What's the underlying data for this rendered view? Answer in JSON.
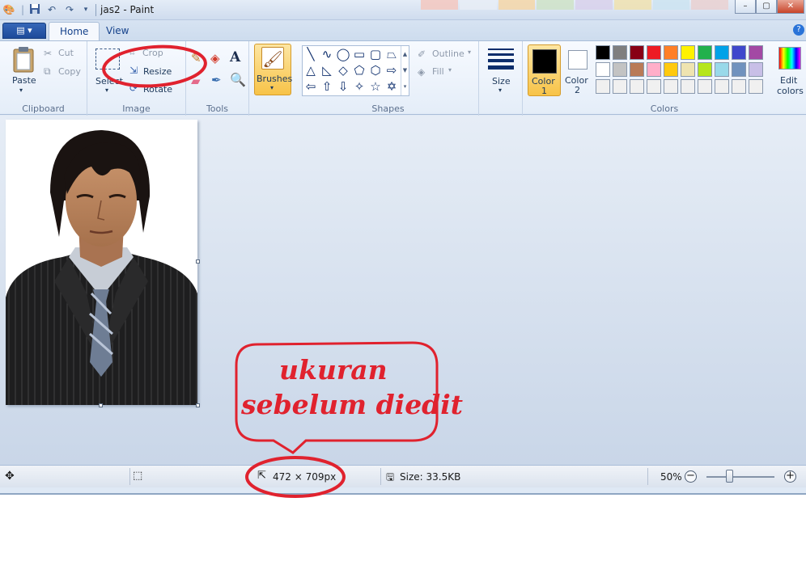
{
  "window": {
    "title": "jas2 - Paint",
    "system_buttons": {
      "minimize": "–",
      "maximize": "▢",
      "close": "✕"
    }
  },
  "quick_access": {
    "app_icon": "paint-palette-icon",
    "save_icon": "save-icon",
    "undo_icon": "undo-icon",
    "redo_icon": "redo-icon",
    "customize_icon": "dropdown-icon"
  },
  "tabs": {
    "app_menu": "▤ ▾",
    "home": "Home",
    "view": "View"
  },
  "ribbon": {
    "clipboard": {
      "label": "Clipboard",
      "paste": "Paste",
      "cut": "Cut",
      "copy": "Copy"
    },
    "image": {
      "label": "Image",
      "select": "Select",
      "crop": "Crop",
      "resize": "Resize",
      "rotate": "Rotate"
    },
    "tools": {
      "label": "Tools"
    },
    "brushes": {
      "label": "Brushes"
    },
    "shapes": {
      "label": "Shapes",
      "outline": "Outline",
      "fill": "Fill"
    },
    "size": {
      "label": "Size"
    },
    "colors": {
      "label": "Colors",
      "color1_label": "Color",
      "color1_num": "1",
      "color2_label": "Color",
      "color2_num": "2",
      "color1_value": "#000000",
      "color2_value": "#ffffff",
      "edit_colors": "Edit",
      "edit_colors_2": "colors",
      "palette_row1": [
        "#000000",
        "#7f7f7f",
        "#880015",
        "#ed1c24",
        "#ff7f27",
        "#fff200",
        "#22b14c",
        "#00a2e8",
        "#3f48cc",
        "#a349a4"
      ],
      "palette_row2": [
        "#ffffff",
        "#c3c3c3",
        "#b97a57",
        "#ffaec9",
        "#ffc90e",
        "#efe4b0",
        "#b5e61d",
        "#99d9ea",
        "#7092be",
        "#c8bfe7"
      ],
      "palette_row3": [
        "#f0f0f0",
        "#f0f0f0",
        "#f0f0f0",
        "#f0f0f0",
        "#f0f0f0",
        "#f0f0f0",
        "#f0f0f0",
        "#f0f0f0",
        "#f0f0f0",
        "#f0f0f0"
      ]
    }
  },
  "status": {
    "pixel_size": "472 × 709px",
    "file_size": "Size: 33.5KB",
    "zoom": "50%",
    "zoom_level": 0.5
  },
  "annotation": {
    "line1": "ukuran",
    "line2": "sebelum diedit",
    "color": "#e0222e"
  }
}
